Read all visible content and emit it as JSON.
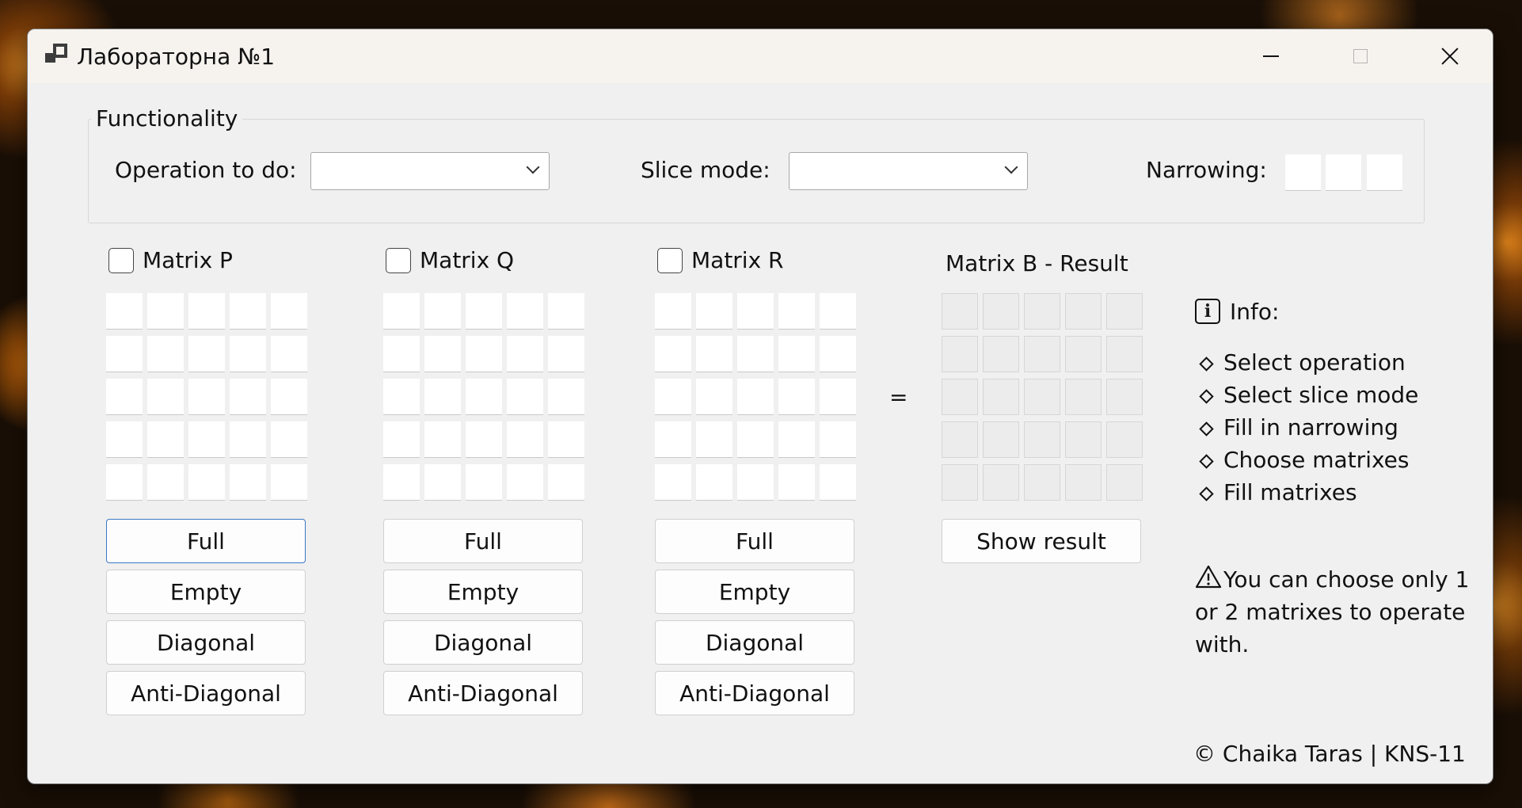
{
  "window": {
    "title": "Лабораторна №1"
  },
  "functionality": {
    "legend": "Functionality",
    "operation_label": "Operation to do:",
    "operation_value": "",
    "slice_label": "Slice mode:",
    "slice_value": "",
    "narrowing_label": "Narrowing:",
    "narrowing_values": [
      "",
      "",
      ""
    ]
  },
  "matrices": [
    {
      "label": "Matrix P",
      "checked": false
    },
    {
      "label": "Matrix Q",
      "checked": false
    },
    {
      "label": "Matrix R",
      "checked": false
    }
  ],
  "result": {
    "label": "Matrix B - Result",
    "equals": "=",
    "show_button": "Show result"
  },
  "buttons": {
    "full": "Full",
    "empty": "Empty",
    "diagonal": "Diagonal",
    "anti_diagonal": "Anti-Diagonal"
  },
  "info": {
    "icon": "info-icon",
    "title": "Info:",
    "steps": [
      "Select operation",
      "Select slice mode",
      "Fill in narrowing",
      "Choose matrixes",
      "Fill matrixes"
    ],
    "warning": "You can choose only 1 or 2 matrixes to operate with."
  },
  "footer": "© Chaika Taras | KNS-11"
}
